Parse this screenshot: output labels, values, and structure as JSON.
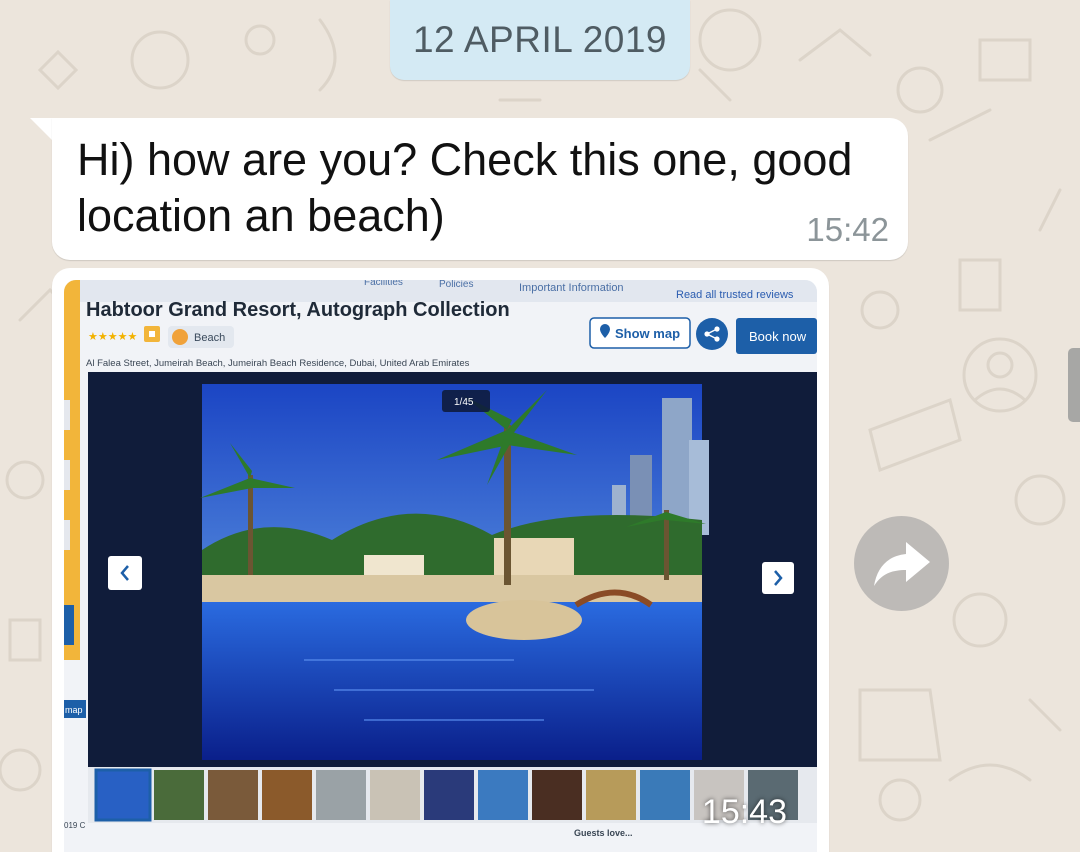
{
  "chat": {
    "date_chip": "12 APRIL 2019",
    "messages": [
      {
        "type": "text",
        "direction": "incoming",
        "text": "Hi) how are you? Check this one, good location an beach)",
        "time": "15:42"
      },
      {
        "type": "image",
        "direction": "incoming",
        "time": "15:43",
        "image": {
          "nav_tabs": [
            "Facilities",
            "Policies",
            "Important Information",
            "Read all trusted reviews"
          ],
          "hotel_name": "Habtoor Grand Resort, Autograph Collection",
          "stars": "★★★★★",
          "badge": "Beach",
          "address": "Al Falea Street, Jumeirah Beach, Jumeirah Beach Residence, Dubai, United Arab Emirates",
          "show_map": "Show map",
          "book_now": "Book now",
          "photo_counter": "1/45",
          "side_tab": "map",
          "bottom_left": "019 C",
          "bottom_text": "Guests love..."
        }
      }
    ]
  },
  "icons": {
    "forward": "forward-arrow-icon",
    "prev": "chevron-left-icon",
    "next": "chevron-right-icon",
    "pin": "map-pin-icon",
    "share": "share-icon",
    "thumbs": "thumbs-up-icon"
  },
  "colors": {
    "wallpaper": "#ece5dc",
    "date_chip_bg": "#d4eaf4",
    "bubble": "#ffffff",
    "time_text": "#8c9599",
    "site_blue": "#1d5fa8"
  }
}
